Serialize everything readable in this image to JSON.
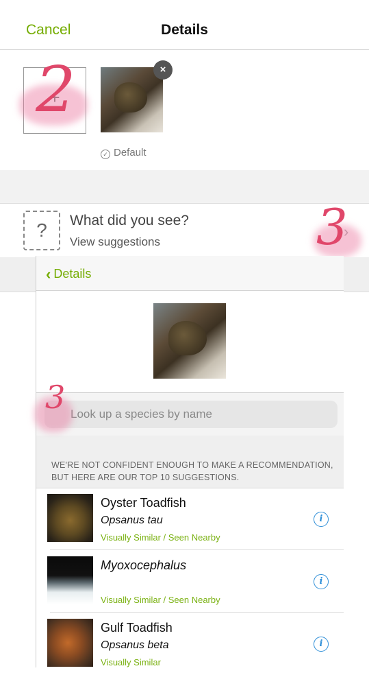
{
  "nav": {
    "cancel": "Cancel",
    "title": "Details"
  },
  "photos": {
    "default_label": "Default",
    "add_symbol": "+",
    "remove_symbol": "×",
    "annotation": "2"
  },
  "identify": {
    "title": "What did you see?",
    "subtitle": "View suggestions",
    "placeholder_glyph": "?",
    "annotation": "3"
  },
  "suggestions": {
    "back_label": "Details",
    "search_placeholder": "Look up a species by name",
    "search_annotation": "3",
    "notice": "WE'RE NOT CONFIDENT ENOUGH TO MAKE A RECOMMENDATION, BUT HERE ARE OUR TOP 10 SUGGESTIONS.",
    "items": [
      {
        "name": "Oyster Toadfish",
        "scientific": "Opsanus tau",
        "tag": "Visually Similar / Seen Nearby"
      },
      {
        "name": "",
        "scientific": "Myoxocephalus",
        "tag": "Visually Similar / Seen Nearby"
      },
      {
        "name": "Gulf Toadfish",
        "scientific": "Opsanus beta",
        "tag": "Visually Similar"
      }
    ]
  },
  "colors": {
    "accent": "#74ac00",
    "info": "#2f8fd8",
    "annotation": "#e0476a"
  }
}
